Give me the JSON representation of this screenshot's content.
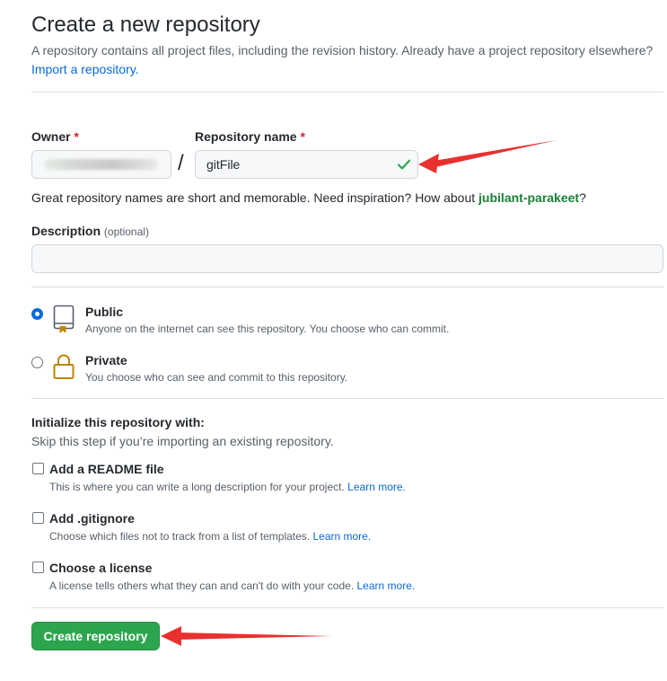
{
  "header": {
    "title": "Create a new repository",
    "subtitle": "A repository contains all project files, including the revision history. Already have a project repository elsewhere?",
    "import_link": "Import a repository."
  },
  "owner": {
    "label": "Owner",
    "required_mark": "*"
  },
  "repo_name": {
    "label": "Repository name",
    "required_mark": "*",
    "value": "gitFile",
    "valid_icon": "check-icon"
  },
  "hint": {
    "text": "Great repository names are short and memorable. Need inspiration? How about ",
    "suggestion": "jubilant-parakeet",
    "end": "?"
  },
  "description": {
    "label": "Description",
    "optional": "(optional)",
    "value": ""
  },
  "visibility": {
    "selected": "public",
    "public": {
      "title": "Public",
      "desc": "Anyone on the internet can see this repository. You choose who can commit.",
      "icon": "repo-book-icon"
    },
    "private": {
      "title": "Private",
      "desc": "You choose who can see and commit to this repository.",
      "icon": "lock-icon"
    }
  },
  "init": {
    "title": "Initialize this repository with:",
    "subtitle": "Skip this step if you’re importing an existing repository.",
    "options": [
      {
        "label": "Add a README file",
        "desc": "This is where you can write a long description for your project.",
        "link": "Learn more."
      },
      {
        "label": "Add .gitignore",
        "desc": "Choose which files not to track from a list of templates.",
        "link": "Learn more."
      },
      {
        "label": "Choose a license",
        "desc": "A license tells others what they can and can't do with your code.",
        "link": "Learn more."
      }
    ]
  },
  "actions": {
    "create_label": "Create repository"
  },
  "colors": {
    "primary_button": "#2da44e",
    "link": "#0969da",
    "success": "#1a7f37",
    "annotation_arrow": "#e8312f",
    "lock": "#bf8700"
  }
}
